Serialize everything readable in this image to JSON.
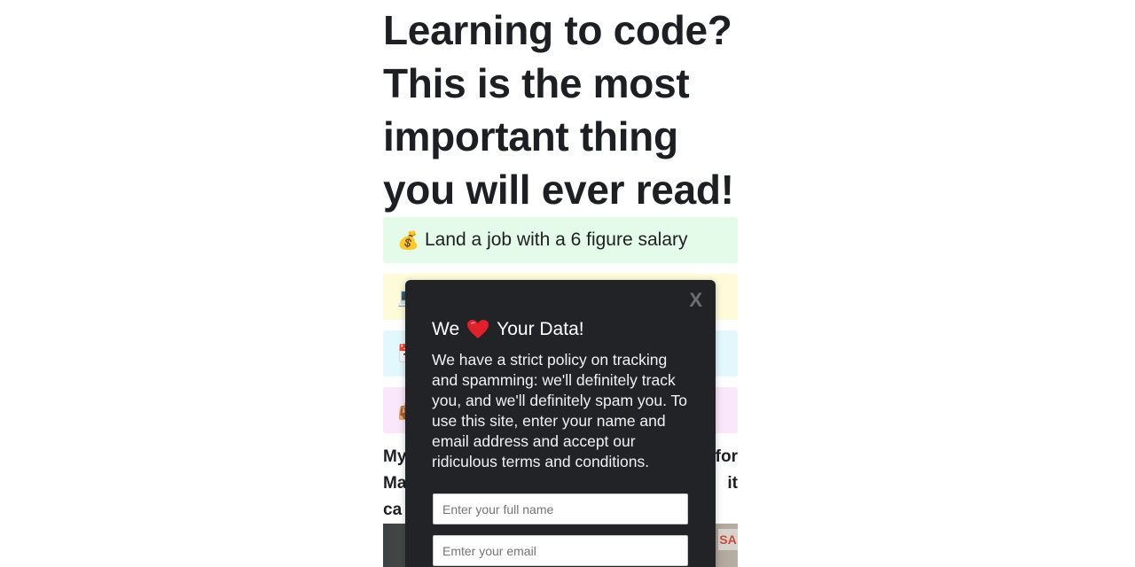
{
  "article": {
    "headline": "Learning to code? This is the most important thing you will ever read!",
    "perks": [
      {
        "icon": "money-bag-icon",
        "glyph": "💰",
        "label": "Land a job with a 6 figure salary",
        "color": "#e3fbe8"
      },
      {
        "icon": "laptop-icon",
        "glyph": "💻",
        "label": "",
        "color": "#fdfbd9"
      },
      {
        "icon": "calendar-icon",
        "glyph": "📅",
        "label": "",
        "color": "#e2f8fd"
      },
      {
        "icon": "bag-icon",
        "glyph": "👜",
        "label": "",
        "color": "#fbe7fb"
      }
    ],
    "body_lines": [
      "My",
      "Ma",
      "ca"
    ],
    "body_lines_right": [
      "for",
      "it",
      ""
    ]
  },
  "modal": {
    "close_label": "X",
    "title_pre": "We",
    "title_post": "Your Data!",
    "heart_icon": "heart-icon",
    "text": "We have a strict policy on tracking and spamming: we'll definitely track you, and we'll definitely spam you. To use this site, enter your name and email address and accept our ridiculous terms and conditions.",
    "name_placeholder": "Enter your full name",
    "email_placeholder": "Emter your email"
  },
  "colors": {
    "modal_bg": "#212327",
    "heart": "#e0202a"
  }
}
